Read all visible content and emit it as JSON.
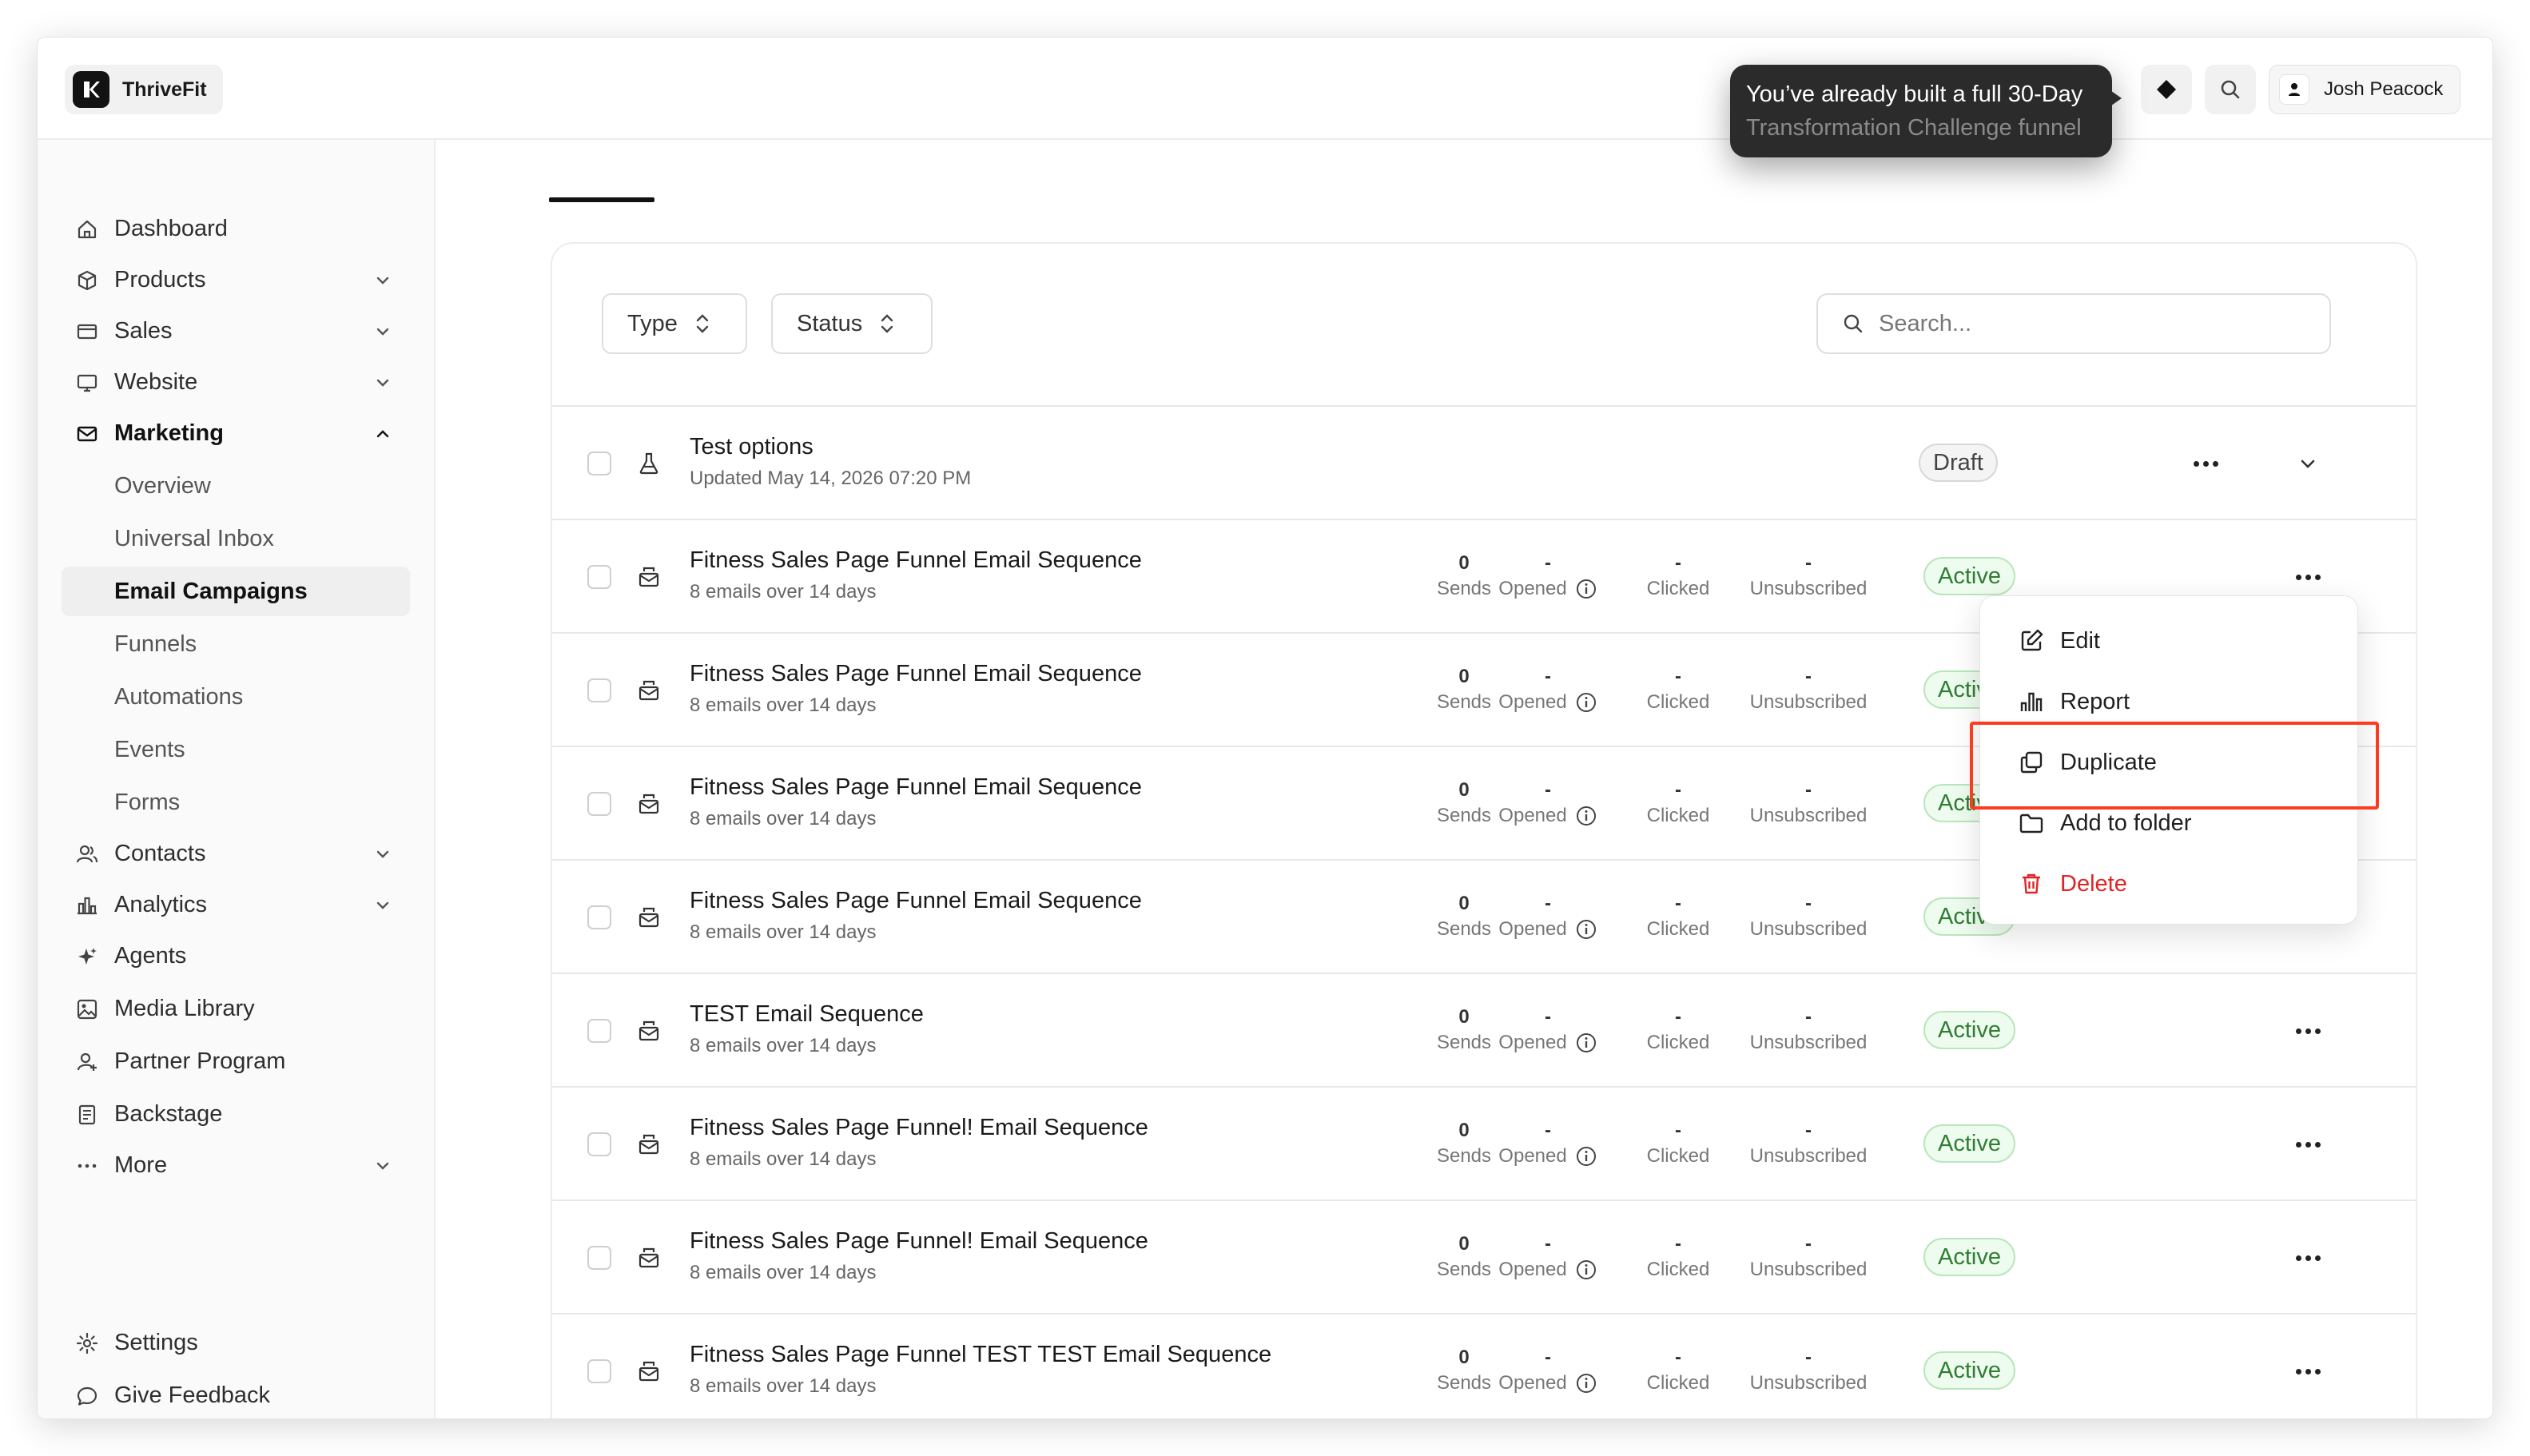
{
  "app": {
    "name": "ThriveFit"
  },
  "header": {
    "tooltip_line1": "You’ve already built a full 30-Day",
    "tooltip_line2": "Transformation Challenge funnel",
    "user_name": "Josh Peacock"
  },
  "sidebar": {
    "items": [
      {
        "label": "Dashboard",
        "icon": "home-icon"
      },
      {
        "label": "Products",
        "icon": "box-icon"
      },
      {
        "label": "Sales",
        "icon": "card-icon"
      },
      {
        "label": "Website",
        "icon": "monitor-icon"
      },
      {
        "label": "Marketing",
        "icon": "mail-icon"
      }
    ],
    "marketing_sub": [
      "Overview",
      "Universal Inbox",
      "Email Campaigns",
      "Funnels",
      "Automations",
      "Events",
      "Forms"
    ],
    "items2": [
      {
        "label": "Contacts",
        "icon": "users-icon"
      },
      {
        "label": "Analytics",
        "icon": "chart-icon"
      },
      {
        "label": "Agents",
        "icon": "sparkle-icon"
      },
      {
        "label": "Media Library",
        "icon": "image-icon"
      },
      {
        "label": "Partner Program",
        "icon": "partner-icon"
      },
      {
        "label": "Backstage",
        "icon": "book-icon"
      },
      {
        "label": "More",
        "icon": "more-icon"
      }
    ],
    "bottom": [
      {
        "label": "Settings",
        "icon": "gear-icon"
      },
      {
        "label": "Give Feedback",
        "icon": "chat-icon"
      }
    ]
  },
  "filters": {
    "type_label": "Type",
    "status_label": "Status",
    "search_placeholder": "Search..."
  },
  "metric_labels": {
    "sends": "Sends",
    "opened": "Opened",
    "clicked": "Clicked",
    "unsubscribed": "Unsubscribed"
  },
  "rows": [
    {
      "title": "Test options",
      "subtitle": "Updated May 14, 2026 07:20 PM",
      "status": "Draft"
    },
    {
      "title": "Fitness Sales Page Funnel Email Sequence",
      "subtitle": "8 emails over 14 days",
      "sends": "0",
      "opened": "-",
      "clicked": "-",
      "unsubscribed": "-",
      "status": "Active"
    },
    {
      "title": "Fitness Sales Page Funnel Email Sequence",
      "subtitle": "8 emails over 14 days",
      "sends": "0",
      "opened": "-",
      "clicked": "-",
      "unsubscribed": "-",
      "status": "Active"
    },
    {
      "title": "Fitness Sales Page Funnel Email Sequence",
      "subtitle": "8 emails over 14 days",
      "sends": "0",
      "opened": "-",
      "clicked": "-",
      "unsubscribed": "-",
      "status": "Active"
    },
    {
      "title": "Fitness Sales Page Funnel Email Sequence",
      "subtitle": "8 emails over 14 days",
      "sends": "0",
      "opened": "-",
      "clicked": "-",
      "unsubscribed": "-",
      "status": "Active"
    },
    {
      "title": "TEST Email Sequence",
      "subtitle": "8 emails over 14 days",
      "sends": "0",
      "opened": "-",
      "clicked": "-",
      "unsubscribed": "-",
      "status": "Active"
    },
    {
      "title": "Fitness Sales Page Funnel! Email Sequence",
      "subtitle": "8 emails over 14 days",
      "sends": "0",
      "opened": "-",
      "clicked": "-",
      "unsubscribed": "-",
      "status": "Active"
    },
    {
      "title": "Fitness Sales Page Funnel! Email Sequence",
      "subtitle": "8 emails over 14 days",
      "sends": "0",
      "opened": "-",
      "clicked": "-",
      "unsubscribed": "-",
      "status": "Active"
    },
    {
      "title": "Fitness Sales Page Funnel TEST TEST Email Sequence",
      "subtitle": "8 emails over 14 days",
      "sends": "0",
      "opened": "-",
      "clicked": "-",
      "unsubscribed": "-",
      "status": "Active"
    }
  ],
  "context_menu": {
    "items": [
      {
        "label": "Edit",
        "icon": "edit-icon"
      },
      {
        "label": "Report",
        "icon": "bar-chart-icon"
      },
      {
        "label": "Duplicate",
        "icon": "duplicate-icon"
      },
      {
        "label": "Add to folder",
        "icon": "folder-icon"
      },
      {
        "label": "Delete",
        "icon": "trash-icon"
      }
    ]
  },
  "colors": {
    "active_green": "#2f7d32",
    "delete_red": "#e02424",
    "highlight": "#ff3b1f"
  }
}
